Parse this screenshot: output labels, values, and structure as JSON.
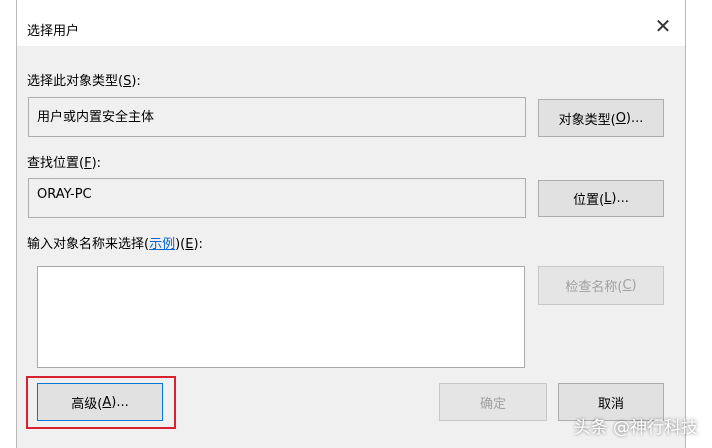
{
  "dialog": {
    "title": "选择用户",
    "close_glyph": "✕"
  },
  "object_type": {
    "label_prefix": "选择此对象类型(",
    "label_key": "S",
    "label_suffix": "):",
    "value": "用户或内置安全主体",
    "button_prefix": "对象类型(",
    "button_key": "O",
    "button_suffix": ")..."
  },
  "location": {
    "label_prefix": "查找位置(",
    "label_key": "F",
    "label_suffix": "):",
    "value": "ORAY-PC",
    "button_prefix": "位置(",
    "button_key": "L",
    "button_suffix": ")..."
  },
  "names": {
    "label_prefix": "输入对象名称来选择(",
    "link_text": "示例",
    "label_mid": ")(",
    "label_key": "E",
    "label_suffix": "):",
    "check_prefix": "检查名称(",
    "check_key": "C",
    "check_suffix": ")"
  },
  "footer": {
    "advanced_prefix": "高级(",
    "advanced_key": "A",
    "advanced_suffix": ")...",
    "ok_label": "确定",
    "cancel_label": "取消"
  },
  "watermark": "头条 @神行科技",
  "colors": {
    "highlight": "#d8212f",
    "link": "#0066cc",
    "focus_border": "#0078d7"
  }
}
